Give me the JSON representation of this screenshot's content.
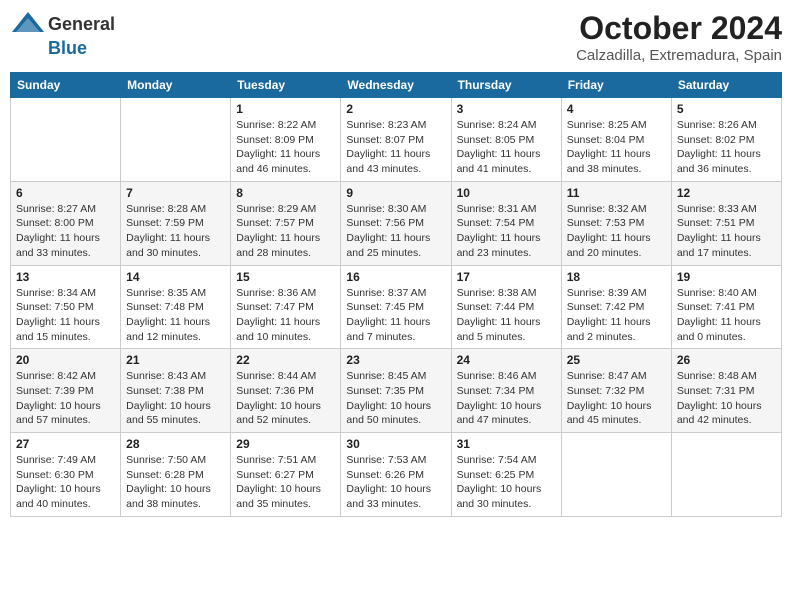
{
  "logo": {
    "general": "General",
    "blue": "Blue"
  },
  "title": {
    "month_year": "October 2024",
    "location": "Calzadilla, Extremadura, Spain"
  },
  "days_of_week": [
    "Sunday",
    "Monday",
    "Tuesday",
    "Wednesday",
    "Thursday",
    "Friday",
    "Saturday"
  ],
  "weeks": [
    [
      {
        "day": "",
        "info": ""
      },
      {
        "day": "",
        "info": ""
      },
      {
        "day": "1",
        "info": "Sunrise: 8:22 AM\nSunset: 8:09 PM\nDaylight: 11 hours and 46 minutes."
      },
      {
        "day": "2",
        "info": "Sunrise: 8:23 AM\nSunset: 8:07 PM\nDaylight: 11 hours and 43 minutes."
      },
      {
        "day": "3",
        "info": "Sunrise: 8:24 AM\nSunset: 8:05 PM\nDaylight: 11 hours and 41 minutes."
      },
      {
        "day": "4",
        "info": "Sunrise: 8:25 AM\nSunset: 8:04 PM\nDaylight: 11 hours and 38 minutes."
      },
      {
        "day": "5",
        "info": "Sunrise: 8:26 AM\nSunset: 8:02 PM\nDaylight: 11 hours and 36 minutes."
      }
    ],
    [
      {
        "day": "6",
        "info": "Sunrise: 8:27 AM\nSunset: 8:00 PM\nDaylight: 11 hours and 33 minutes."
      },
      {
        "day": "7",
        "info": "Sunrise: 8:28 AM\nSunset: 7:59 PM\nDaylight: 11 hours and 30 minutes."
      },
      {
        "day": "8",
        "info": "Sunrise: 8:29 AM\nSunset: 7:57 PM\nDaylight: 11 hours and 28 minutes."
      },
      {
        "day": "9",
        "info": "Sunrise: 8:30 AM\nSunset: 7:56 PM\nDaylight: 11 hours and 25 minutes."
      },
      {
        "day": "10",
        "info": "Sunrise: 8:31 AM\nSunset: 7:54 PM\nDaylight: 11 hours and 23 minutes."
      },
      {
        "day": "11",
        "info": "Sunrise: 8:32 AM\nSunset: 7:53 PM\nDaylight: 11 hours and 20 minutes."
      },
      {
        "day": "12",
        "info": "Sunrise: 8:33 AM\nSunset: 7:51 PM\nDaylight: 11 hours and 17 minutes."
      }
    ],
    [
      {
        "day": "13",
        "info": "Sunrise: 8:34 AM\nSunset: 7:50 PM\nDaylight: 11 hours and 15 minutes."
      },
      {
        "day": "14",
        "info": "Sunrise: 8:35 AM\nSunset: 7:48 PM\nDaylight: 11 hours and 12 minutes."
      },
      {
        "day": "15",
        "info": "Sunrise: 8:36 AM\nSunset: 7:47 PM\nDaylight: 11 hours and 10 minutes."
      },
      {
        "day": "16",
        "info": "Sunrise: 8:37 AM\nSunset: 7:45 PM\nDaylight: 11 hours and 7 minutes."
      },
      {
        "day": "17",
        "info": "Sunrise: 8:38 AM\nSunset: 7:44 PM\nDaylight: 11 hours and 5 minutes."
      },
      {
        "day": "18",
        "info": "Sunrise: 8:39 AM\nSunset: 7:42 PM\nDaylight: 11 hours and 2 minutes."
      },
      {
        "day": "19",
        "info": "Sunrise: 8:40 AM\nSunset: 7:41 PM\nDaylight: 11 hours and 0 minutes."
      }
    ],
    [
      {
        "day": "20",
        "info": "Sunrise: 8:42 AM\nSunset: 7:39 PM\nDaylight: 10 hours and 57 minutes."
      },
      {
        "day": "21",
        "info": "Sunrise: 8:43 AM\nSunset: 7:38 PM\nDaylight: 10 hours and 55 minutes."
      },
      {
        "day": "22",
        "info": "Sunrise: 8:44 AM\nSunset: 7:36 PM\nDaylight: 10 hours and 52 minutes."
      },
      {
        "day": "23",
        "info": "Sunrise: 8:45 AM\nSunset: 7:35 PM\nDaylight: 10 hours and 50 minutes."
      },
      {
        "day": "24",
        "info": "Sunrise: 8:46 AM\nSunset: 7:34 PM\nDaylight: 10 hours and 47 minutes."
      },
      {
        "day": "25",
        "info": "Sunrise: 8:47 AM\nSunset: 7:32 PM\nDaylight: 10 hours and 45 minutes."
      },
      {
        "day": "26",
        "info": "Sunrise: 8:48 AM\nSunset: 7:31 PM\nDaylight: 10 hours and 42 minutes."
      }
    ],
    [
      {
        "day": "27",
        "info": "Sunrise: 7:49 AM\nSunset: 6:30 PM\nDaylight: 10 hours and 40 minutes."
      },
      {
        "day": "28",
        "info": "Sunrise: 7:50 AM\nSunset: 6:28 PM\nDaylight: 10 hours and 38 minutes."
      },
      {
        "day": "29",
        "info": "Sunrise: 7:51 AM\nSunset: 6:27 PM\nDaylight: 10 hours and 35 minutes."
      },
      {
        "day": "30",
        "info": "Sunrise: 7:53 AM\nSunset: 6:26 PM\nDaylight: 10 hours and 33 minutes."
      },
      {
        "day": "31",
        "info": "Sunrise: 7:54 AM\nSunset: 6:25 PM\nDaylight: 10 hours and 30 minutes."
      },
      {
        "day": "",
        "info": ""
      },
      {
        "day": "",
        "info": ""
      }
    ]
  ]
}
